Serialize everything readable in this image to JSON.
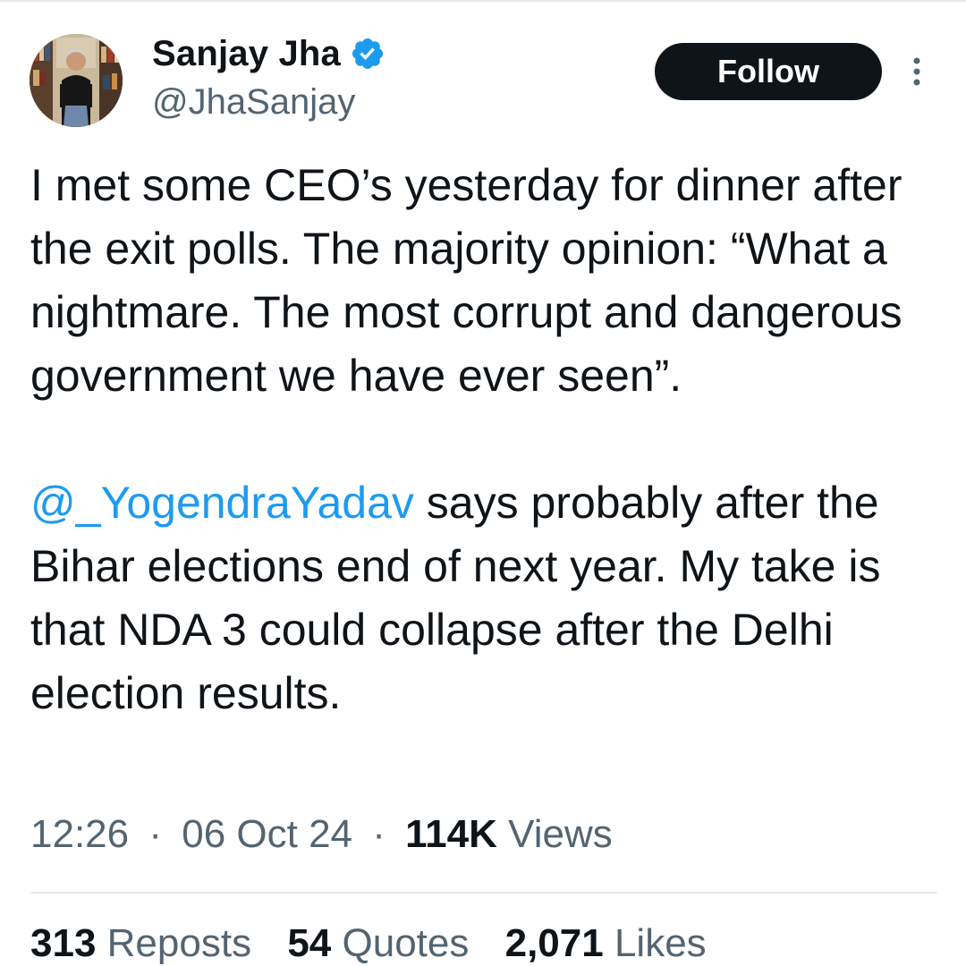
{
  "author": {
    "display_name": "Sanjay Jha",
    "handle": "@JhaSanjay",
    "verified_icon": "verified-badge-icon",
    "avatar_icon": "profile-photo"
  },
  "actions": {
    "follow_label": "Follow",
    "more_icon": "more-vertical-icon"
  },
  "tweet": {
    "paragraph1": "I met some CEO’s yesterday for dinner after the exit polls. The majority opinion: “What a nightmare. The most corrupt and dangerous government we have ever seen”.",
    "mention": "@_YogendraYadav",
    "paragraph2_rest": " says probably after the Bihar elections end of next year. My take is that NDA 3 could collapse after the Delhi election results."
  },
  "meta": {
    "time": "12:26",
    "separator": "·",
    "date": "06 Oct 24",
    "views_count": "114K",
    "views_label": "Views"
  },
  "stats": {
    "reposts_count": "313",
    "reposts_label": "Reposts",
    "quotes_count": "54",
    "quotes_label": "Quotes",
    "likes_count": "2,071",
    "likes_label": "Likes"
  },
  "colors": {
    "text": "#0f1419",
    "secondary": "#536471",
    "link": "#1d9bf0",
    "button_bg": "#0f1419",
    "divider": "#e6e9ec"
  }
}
